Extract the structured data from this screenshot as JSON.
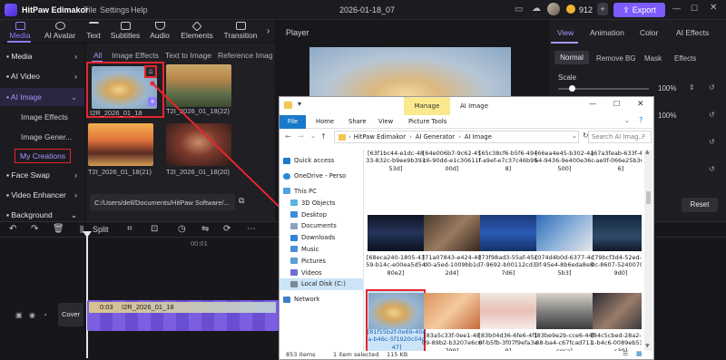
{
  "app": {
    "title": "HitPaw Edimakor",
    "menu": [
      "File",
      "Settings",
      "Help"
    ],
    "project_name": "2026-01-18_07",
    "credits": "912",
    "export_label": "Export"
  },
  "toolbar": {
    "tabs": [
      "Media",
      "AI Avatar",
      "Text",
      "Subtitles",
      "Audio",
      "Elements",
      "Transition"
    ]
  },
  "nav": {
    "media": "Media",
    "ai_video": "AI Video",
    "ai_image": "AI Image",
    "sub": [
      "Image Effects",
      "Image Gener...",
      "My Creations"
    ],
    "face_swap": "Face Swap",
    "video_enhancer": "Video Enhancer",
    "background": "Background"
  },
  "media_panel": {
    "tabs": [
      "All",
      "Image Effects",
      "Text to Image",
      "Reference Image"
    ],
    "items": [
      "I2R_2026_01_18",
      "T2I_2026_01_18(22)",
      "T2I_2026_01_18(21)",
      "T2I_2026_01_18(20)"
    ],
    "path": "C:/Users/dell/Documents/HitPaw Software/..."
  },
  "player": {
    "title": "Player"
  },
  "right_panel": {
    "tabs": [
      "View",
      "Animation",
      "Color",
      "AI Effects"
    ],
    "subtabs": [
      "Normal",
      "Remove BG",
      "Mask",
      "Effects"
    ],
    "scale_label": "Scale",
    "scale_value": "100%",
    "value2": "100%",
    "reset_label": "Reset"
  },
  "timeline": {
    "split_label": "Split",
    "ruler_time": "00:01",
    "cover_label": "Cover",
    "clip_time": "0:03",
    "clip_name": "I2R_2026_01_18"
  },
  "explorer": {
    "manage_tab": "Manage",
    "title": "AI Image",
    "ribbon": [
      "File",
      "Home",
      "Share",
      "View",
      "Picture Tools"
    ],
    "breadcrumb": [
      "HitPaw Edimakor",
      "AI Generator",
      "AI Image"
    ],
    "search_placeholder": "Search AI Imag...",
    "sidebar": [
      "Quick access",
      "OneDrive - Perso",
      "This PC",
      "3D Objects",
      "Desktop",
      "Documents",
      "Downloads",
      "Music",
      "Pictures",
      "Videos",
      "Local Disk (C:)",
      "Network"
    ],
    "files": [
      "[63f1bc44-e1dc-4833-832c-b9ee9b39353d]",
      "[64e006b7-9c62-45c6-90dd-e1c30611f00d]",
      "[65c38cf6-b5f6-494f-a9ef-e7c37c46b958]",
      "[66ea4e45-b302-4a64-9436-9e400e36c500]",
      "[67a3feab-633f-474-ae0f-066e25b3606]",
      "[68eca240-1805-4359-b14c-e00ea5d5480e2]",
      "[71a07843-e424-40d0-a5ed-1009bb1d2d4]",
      "[73f98ad3-55af-45c7-9692-b00112cd37d6]",
      "[074d4b0d-6377-4c3f-95e4-8b6eda8e85b3]",
      "[79bcf3d4-52ed-410c-8607-5240070c49d0]",
      "[81f55b2f-0e69-40da-b46c-5f1920c04d47]",
      "[83a5c33f-0ee1-4809-89b2-b3207e6c6799]",
      "[83b04d36-6fe6-4f10f-b5fb-3f07f9efa3e9]",
      "[83be9e2b-cce6-44f88-ba4-c67fcad711ceca]",
      "[84c5cbed-28a2-4cf1-b4c6-0089eb5333c30]"
    ],
    "status": {
      "count": "853 items",
      "selected": "1 item selected",
      "size": "115 KB"
    }
  },
  "colors": {
    "accent": "#7c5cff",
    "highlight_box": "#e5262d",
    "explorer_select": "#cce4f7"
  }
}
